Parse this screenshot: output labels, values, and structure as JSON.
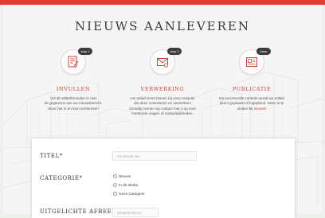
{
  "page": {
    "title": "NIEUWS AANLEVEREN"
  },
  "steps": [
    {
      "badge": "stap 1",
      "icon": "form-icon",
      "title": "INVULLEN",
      "desc": [
        "Vul dit artikelformulier in met",
        "de gegevens van uw nieuwsbericht.",
        "Stuur het in en leun achterover!"
      ]
    },
    {
      "badge": "stap 2",
      "icon": "mail-icon",
      "title": "VERWERKING",
      "desc": [
        "Uw artikel komt binnen bij onze redactie",
        "die deze controleren en verwerken!",
        "Zonodig nemen wij contact met u op voor",
        "eventuele vragen of onduidelijkheden."
      ]
    },
    {
      "badge": "klaar",
      "icon": "newspaper-icon",
      "title": "PUBLICATIE",
      "desc": [
        "Na succesvolle controle wordt uw artikel",
        "direct geplaatst of ingepland. Deze is te",
        "vinden bij"
      ],
      "link": "nieuws!"
    }
  ],
  "form": {
    "title_label": "TITEL*",
    "title_placeholder": "Voorbeeld titel",
    "category_label": "CATEGORIE*",
    "categories": [
      "Nieuws",
      "In de Media",
      "Geen Categorie"
    ],
    "image_label": "UITGELICHTE AFBEELDING *",
    "image_button": "Bestand kiezen"
  },
  "colors": {
    "accent": "#e53b35",
    "background": "#f4f5f4"
  }
}
